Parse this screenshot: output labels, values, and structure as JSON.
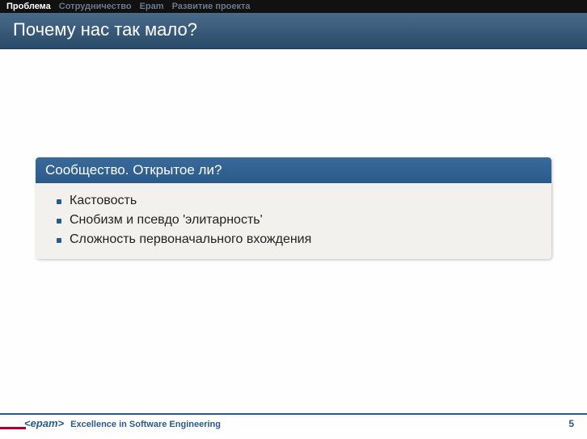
{
  "nav": {
    "items": [
      {
        "label": "Проблема",
        "active": true
      },
      {
        "label": "Сотрудничество",
        "active": false
      },
      {
        "label": "Epam",
        "active": false
      },
      {
        "label": "Развитие проекта",
        "active": false
      }
    ]
  },
  "title": "Почему нас так мало?",
  "block": {
    "title": "Сообщество. Открытое ли?",
    "items": [
      "Кастовость",
      "Снобизм и псевдо 'элитарность'",
      "Сложность первоначального вхождения"
    ]
  },
  "footer": {
    "logo": "<epam>",
    "tagline": "Excellence in Software Engineering",
    "page": "5"
  }
}
